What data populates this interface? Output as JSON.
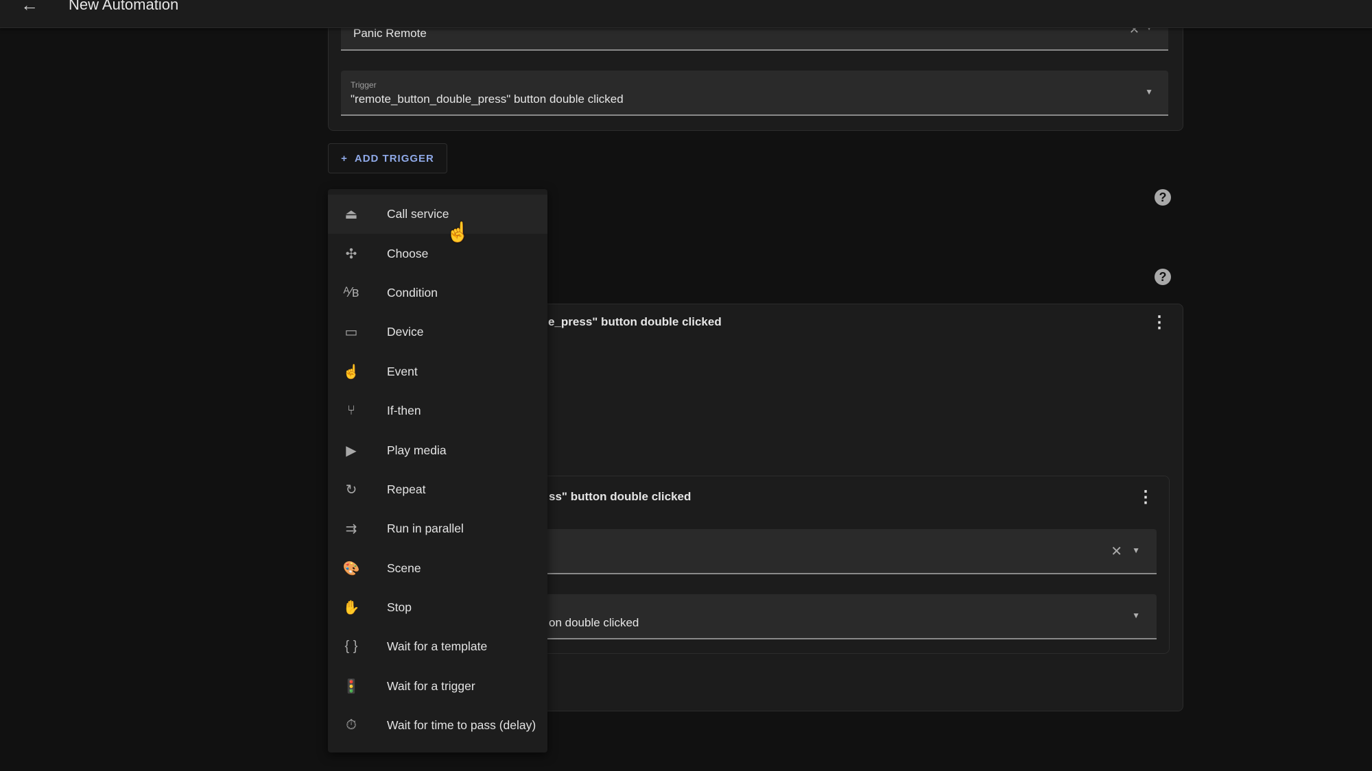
{
  "header": {
    "title": "New Automation",
    "back_icon": "arrow-left-icon"
  },
  "trigger_card": {
    "device_field": {
      "value": "Panic Remote"
    },
    "trigger_field": {
      "label": "Trigger",
      "value": "\"remote_button_double_press\" button double clicked"
    }
  },
  "add_trigger": {
    "label": "ADD TRIGGER",
    "icon": "+"
  },
  "help": {
    "glyph": "?"
  },
  "action_card": {
    "title_fragment": "e_press\" button double clicked",
    "inner_card": {
      "title_fragment": "ss\" button double clicked",
      "trigger_fragment": "on double clicked"
    }
  },
  "menu": {
    "items": [
      {
        "label": "Call service",
        "icon": "bell-icon",
        "glyph": "⏏"
      },
      {
        "label": "Choose",
        "icon": "source-fork-icon",
        "glyph": "✣"
      },
      {
        "label": "Condition",
        "icon": "ab-testing-icon",
        "glyph": "ᴬ⁄ʙ"
      },
      {
        "label": "Device",
        "icon": "devices-icon",
        "glyph": "▭"
      },
      {
        "label": "Event",
        "icon": "gesture-tap-icon",
        "glyph": "☝"
      },
      {
        "label": "If-then",
        "icon": "call-split-icon",
        "glyph": "⑂"
      },
      {
        "label": "Play media",
        "icon": "play-icon",
        "glyph": "▶"
      },
      {
        "label": "Repeat",
        "icon": "refresh-icon",
        "glyph": "↻"
      },
      {
        "label": "Run in parallel",
        "icon": "shuffle-icon",
        "glyph": "⇉"
      },
      {
        "label": "Scene",
        "icon": "palette-icon",
        "glyph": "🎨"
      },
      {
        "label": "Stop",
        "icon": "hand-icon",
        "glyph": "✋"
      },
      {
        "label": "Wait for a template",
        "icon": "code-braces-icon",
        "glyph": "{ }"
      },
      {
        "label": "Wait for a trigger",
        "icon": "traffic-light-icon",
        "glyph": "🚦"
      },
      {
        "label": "Wait for time to pass (delay)",
        "icon": "timer-icon",
        "glyph": "⏱"
      }
    ]
  }
}
